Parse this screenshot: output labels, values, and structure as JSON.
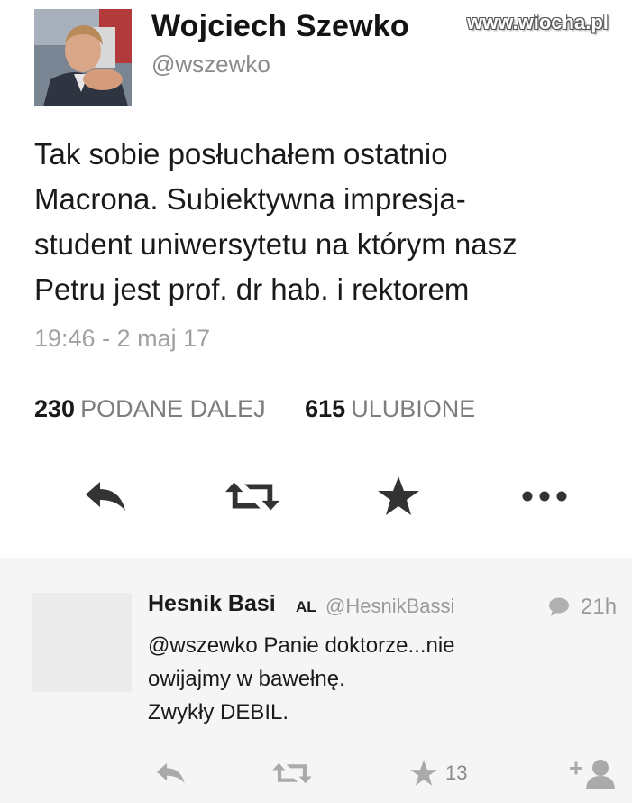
{
  "tweet": {
    "author_name": "Wojciech Szewko",
    "author_handle": "@wszewko",
    "text_lines": [
      "Tak sobie posłuchałem ostatnio",
      "Macrona. Subiektywna impresja-",
      "student uniwersytetu na którym nasz",
      "Petru jest prof. dr hab. i rektorem"
    ],
    "timestamp": "19:46 - 2 maj 17",
    "stats": {
      "retweets_count": "230",
      "retweets_label": "PODANE DALEJ",
      "likes_count": "615",
      "likes_label": "ULUBIONE"
    },
    "actions": [
      "reply-icon",
      "retweet-icon",
      "star-icon",
      "more-icon"
    ]
  },
  "watermark": "www.wiocha.pl",
  "reply": {
    "name": "Hesnik Basi",
    "badge": "AL",
    "handle": "@HesnikBassi",
    "time": "21h",
    "text_lines": [
      "@wszewko Panie doktorze...nie",
      "owijajmy w bawełnę.",
      "Zwykły DEBIL."
    ],
    "likes": "13",
    "actions": [
      "reply-icon",
      "retweet-icon",
      "star-icon",
      "follow-icon"
    ]
  },
  "colors": {
    "text": "#1a1a1a",
    "muted": "#8a8a8a",
    "icon_dark": "#333333",
    "icon_muted": "#aaaaaa",
    "reply_bg": "#f5f5f5"
  }
}
